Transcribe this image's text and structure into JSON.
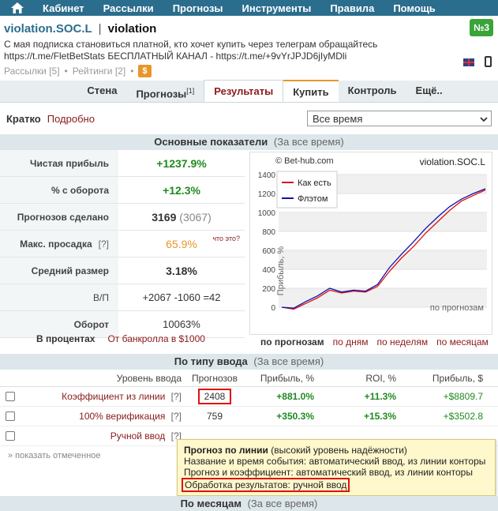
{
  "nav": {
    "items": [
      "Кабинет",
      "Рассылки",
      "Прогнозы",
      "Инструменты",
      "Правила",
      "Помощь"
    ]
  },
  "header": {
    "name": "violation.SOC.L",
    "separator": "|",
    "alias": "violation",
    "description_line1": "С мая подписка становиться платной, кто хочет купить через телеграм обращайтесь",
    "description_line2": "https://t.me/FletBetStats БЕСПЛАТНЫЙ КАНАЛ - https://t.me/+9vYrJPJD6jIyMDli",
    "subscriptions": "Рассылки [5]",
    "dot": "•",
    "ratings": "Рейтинги [2]",
    "dollar": "$",
    "rank": "№3"
  },
  "tabs": [
    {
      "label": "Стена"
    },
    {
      "label": "Прогнозы",
      "sup": "[1]"
    },
    {
      "label": "Результаты"
    },
    {
      "label": "Купить"
    },
    {
      "label": "Контроль"
    },
    {
      "label": "Ещё.."
    }
  ],
  "filter": {
    "short": "Кратко",
    "detailed": "Подробно",
    "period": "Все время"
  },
  "main_section": {
    "title": "Основные показатели",
    "subtitle": "(За все время)",
    "stats": [
      {
        "label": "Чистая прибыль",
        "value": "+1237.9%"
      },
      {
        "label": "% с оборота",
        "value": "+12.3%"
      },
      {
        "label": "Прогнозов сделано",
        "value": "3169",
        "value2": "(3067)"
      },
      {
        "label": "Макс. просадка",
        "label_q": "[?]",
        "value": "65.9%",
        "note": "что это?"
      },
      {
        "label": "Средний размер",
        "value": "3.18%"
      },
      {
        "label": "В/П",
        "value": "+2067 -1060 =42"
      },
      {
        "label": "Оборот",
        "value": "10063%"
      }
    ],
    "in_percent": "В процентах",
    "bankroll_link": "От банкролла в $1000",
    "chart_links": [
      "по прогнозам",
      "по дням",
      "по неделям",
      "по месяцам"
    ]
  },
  "chart_data": {
    "type": "line",
    "title": "violation.SOC.L",
    "watermark": "© Bet-hub.com",
    "ylabel": "Прибыль, %",
    "xlabel": "по прогнозам",
    "ylim": [
      -100,
      1400
    ],
    "yticks": [
      0,
      200,
      400,
      600,
      800,
      1000,
      1200,
      1400
    ],
    "grid": true,
    "legend": "top-left",
    "series": [
      {
        "name": "Как есть",
        "color": "#dd1111",
        "values": [
          0,
          -20,
          40,
          100,
          180,
          150,
          170,
          160,
          220,
          380,
          520,
          640,
          780,
          900,
          1020,
          1120,
          1180,
          1237.9
        ]
      },
      {
        "name": "Флэтом",
        "color": "#1111aa",
        "values": [
          0,
          -10,
          60,
          120,
          200,
          160,
          180,
          170,
          240,
          420,
          560,
          690,
          830,
          950,
          1060,
          1140,
          1200,
          1250
        ]
      }
    ]
  },
  "type_section": {
    "title": "По типу ввода",
    "subtitle": "(За все время)",
    "columns": [
      "Уровень ввода",
      "Прогнозов",
      "Прибыль, %",
      "ROI, %",
      "Прибыль, $"
    ],
    "rows": [
      {
        "level": "Коэффициент из линии",
        "q": "[?]",
        "count": "2408",
        "profit": "+881.0%",
        "roi": "+11.3%",
        "usd": "+$8809.7"
      },
      {
        "level": "100% верификация",
        "q": "[?]",
        "count": "759",
        "profit": "+350.3%",
        "roi": "+15.3%",
        "usd": "+$3502.8"
      },
      {
        "level": "Ручной ввод",
        "q": "[?]",
        "count": "",
        "profit": "",
        "roi": "",
        "usd": ""
      }
    ],
    "show_marked": "» показать отмеченное"
  },
  "tooltip": {
    "title": "Прогноз по линии",
    "title_note": "(высокий уровень надёжности)",
    "line1": "Название и время события: автоматический ввод, из линии конторы",
    "line2": "Прогноз и коэффициент: автоматический ввод, из линии конторы",
    "line3": "Обработка результатов: ручной ввод"
  },
  "bottom_section": {
    "title": "По месяцам",
    "subtitle": "(За все время)"
  }
}
